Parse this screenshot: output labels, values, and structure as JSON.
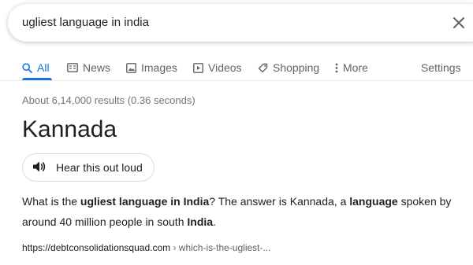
{
  "search": {
    "query": "ugliest language in india"
  },
  "tabs": [
    {
      "label": "All",
      "icon": "search-icon"
    },
    {
      "label": "News",
      "icon": "news-icon"
    },
    {
      "label": "Images",
      "icon": "image-icon"
    },
    {
      "label": "Videos",
      "icon": "video-icon"
    },
    {
      "label": "Shopping",
      "icon": "tag-icon"
    },
    {
      "label": "More",
      "icon": "more-vert-icon"
    }
  ],
  "settings_label": "Settings",
  "result_stats": "About 6,14,000 results (0.36 seconds)",
  "answer": "Kannada",
  "tts_label": "Hear this out loud",
  "snippet": {
    "l1_a": "What is the ",
    "l1_b": "ugliest language in India",
    "l1_c": "? The answer is Kannada, a ",
    "l1_d": "language",
    "l1_e": " spoken by",
    "l2_a": "around 40 million people in south ",
    "l2_b": "India",
    "l2_c": "."
  },
  "source": {
    "domain": "https://debtconsolidationsquad.com",
    "path": " › which-is-the-ugliest-..."
  },
  "colors": {
    "accent": "#1a73e8",
    "link": "#1a0dab",
    "muted": "#70757a"
  }
}
